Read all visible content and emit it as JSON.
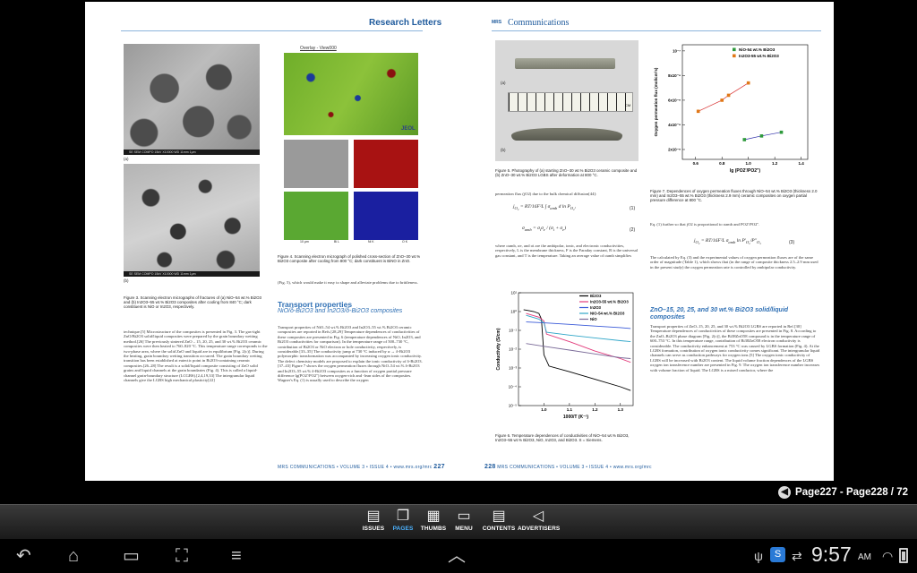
{
  "left_page": {
    "running_head": "Research Letters",
    "fig3_caption": "Figure 3. Scanning electron micrographs of fractures of (a) NiO–54 wt.% Bi2O3 and (b) In2O3–55 wt.% Bi2O3 composites after cooling from 840 °C; dark constituent is NiO or In2O3, respectively.",
    "fig3_label_a": "(a)",
    "fig3_label_b": "(b)",
    "sem_strip": "SE   SEM   COMPO   15kV   X10000   WD 11mm   1μm",
    "overlay_title": "Overlay - View000",
    "jeol_logo": "JEOL",
    "eds_labels": [
      "10 μm",
      "Bi L",
      "Ni K",
      "O K"
    ],
    "fig4_caption": "Figure 4. Scanning electron micrograph of polished cross-section of ZnO–30 wt.% Bi2O3 composite after cooling from 800 °C; dark constituent is BiNO in ZnO.",
    "col1_text": "technique.[5] Microstructure of the composites is presented in Fig. 3.\nThe gas-tight ZnO/Bi2O3 solid/liquid composites were prepared by the grain boundary wetting method.[26] The previously sintered ZnO – 15, 20, 25, and 30 wt.% Bi2O3 ceramic composites were then heated to 760–820 °C. This temperature range corresponds to the two-phase area, where the solid ZnO and liquid are in equilibrium [Fig. 2(c)]. During the heating, grain boundary wetting transition occurred. The grain boundary wetting transition has been established at eutectic point in Bi2O3-containing ceramic composites.[26–28] The result is a solid/liquid composite consisting of ZnO solid grains and liquid channels at the grain boundaries (Fig. 4). This is called a liquid-channel grain-boundary structure (LCGBS).[2,4,19,33] The intergranular liquid channels give the LGBS high mechanical plasticity[22]",
    "col2_text_top": "(Fig. 5), which would make it easy to shape and alleviate problems due to brittleness.",
    "section_title": "Transport properties",
    "section_subtitle": "NiO/δ-Bi2O3 and In2O3/δ-Bi2O3 composites",
    "col2_text": "Transport properties of NiO–54 wt.% Bi2O3 and In2O3–55 wt.% Bi2O3 ceramic composites are reported in Refs.[28,29] Temperature dependences of conductivities of these composites are presented in Fig. 6 (temperature dependences of NiO, In2O3, and Bi2O3 conductivities for comparison). In the temperature range of 500–730 °C, contribution of Bi2O3 or NiO electron or hole conductivity, respectively, is considerable.[33–35] The conductivity jump at 730 °C induced by α → δ-Bi2O3 polymorphic transformation was accompanied by increasing oxygen ionic conductivity. The defect chemistry models are proposed to explain the ionic conductivity of δ-Bi2O3.[37–43]\nFigure 7 shows the oxygen permeation fluxes through NiO–54 wt.% δ-Bi2O3 and In2O3–55 wt.% δ-Bi2O3 composites as a function of oxygen partial pressure difference lg(PO2'/PO2'') between oxygen-rich and -lean sides of the composites. Wagner's Eq. (1) is usually used to describe the oxygen",
    "footer_text": "MRS COMMUNICATIONS • VOLUME 3 • ISSUE 4 • www.mrs.org/mrc",
    "page_number": "227"
  },
  "right_page": {
    "logo_prefix": "MRS",
    "logo_main": "Communications",
    "fig5_label_a": "(a)",
    "fig5_label_b": "(b)",
    "ruler_unit": "CM",
    "fig5_caption": "Figure 5. Photography of (a) starting ZnO–30 wt.% Bi2O3 ceramic composite and (b) ZnO–30 wt.% Bi2O3 LGBS after deformation at 800 °C.",
    "fig6_caption": "Figure 6. Temperature dependences of conductivities of NiO–54 wt.% Bi2O3, In2O3–55 wt.% Bi2O3, NiO, In2O3, and Bi2O3. S = Siemens.",
    "mid_text": "permeation flux (jO2) due to the bulk chemical diffusion[44]:",
    "eq1_num": "(1)",
    "eq2_num": "(2)",
    "mid_text_2": "where σamb, σe, and σi are the ambipolar, ionic, and electronic conductivities, respectively, L is the membrane thickness, F is the Faraday constant, R is the universal gas constant, and T is the temperature. Taking an average value of σamb simplifies",
    "fig7_caption": "Figure 7. Dependences of oxygen permeation fluxes through NiO–54 wt.% Bi2O3 (thickness 2.0 mm) and In2O3–55 wt.% Bi2O3 (thickness 2.9 mm) ceramic composites on oxygen partial pressure difference at 800 °C.",
    "col_right_text_1": "Eq. (1) further so that jO2 is proportional to σamb and PO2'/PO2''.",
    "eq3_num": "(3)",
    "col_right_text_2": "The calculated by Eq. (3) and the experimental values of oxygen permeation fluxes are of the same order of magnitude (Table 1), which shows that (in the range of composite thickness 2.5–2.9 mm used in the present study) the oxygen permeation rate is controlled by ambipolar conductivity.",
    "section_title": "ZnO–15, 20, 25, and 30 wt.% Bi2O3 solid/liquid composites",
    "col_right_text_3": "Transport properties of ZnO–15, 20, 25, and 30 wt.% Bi2O3 LGBS are reported in Ref.[30] Temperature dependences of conductivities of these composites are presented in Fig. 8. According to the ZnO–Bi2O3 phase diagram [Fig. 2(c)], the Bi38ZnO58 compound is in the temperature range of 600–753 °C. In this temperature range, contribution of Bi38ZnO58 electron conductivity is considerable. The conductivity enhancement at 753 °C was caused by LGBS formation (Fig. 4). At the LGBS formation, contribution of oxygen ionic conductivity comes significant. The intergranular liquid channels can serve as conduction pathways for oxygen ions.[5] The oxygen ionic conductivity of LGBS will be increased with Bi2O3 content.\nThe liquid volume fraction dependences of the LGBS oxygen ion transference number are presented in Fig. 9. The oxygen ion transference number increases with volume fraction of liquid. The LGBS is a mixed conductor, where the",
    "footer_text": "MRS COMMUNICATIONS • VOLUME 3 • ISSUE 4 • www.mrs.org/mrc",
    "page_number": "228"
  },
  "chart_data": [
    {
      "type": "line",
      "xlabel": "1000/T (K⁻¹)",
      "ylabel": "Conductivity (S/cm)",
      "x_ticks": [
        "1.0",
        "1.1",
        "1.2",
        "1.3"
      ],
      "y_ticks": [
        "10¹",
        "10⁰",
        "10⁻¹",
        "10⁻²",
        "10⁻³",
        "10⁻⁴",
        "10⁻⁵"
      ],
      "xlim": [
        0.9,
        1.35
      ],
      "ylim_log10": [
        -5,
        1
      ],
      "legend_position": "top-right",
      "series": [
        {
          "name": "Bi2O3",
          "color": "#000000",
          "x": [
            0.92,
            0.94,
            0.96,
            0.98,
            0.99,
            1.0,
            1.02,
            1.1,
            1.2,
            1.3,
            1.34
          ],
          "log_y": [
            0.1,
            0.05,
            0.0,
            -0.1,
            -0.4,
            -2.3,
            -2.9,
            -3.2,
            -3.6,
            -4.0,
            -4.2
          ]
        },
        {
          "name": "In2O3-55 wt.% Bi2O3",
          "color": "#e23a7a",
          "x": [
            0.93,
            0.98,
            1.0,
            1.01,
            1.1,
            1.2,
            1.3,
            1.34
          ],
          "log_y": [
            -0.1,
            -0.3,
            -0.5,
            -1.2,
            -1.6,
            -2.1,
            -2.5,
            -2.7
          ]
        },
        {
          "name": "In2O3",
          "color": "#3a5ad8",
          "x": [
            0.93,
            1.0,
            1.1,
            1.2,
            1.3,
            1.34
          ],
          "log_y": [
            -0.55,
            -0.6,
            -0.68,
            -0.77,
            -0.85,
            -0.9
          ]
        },
        {
          "name": "NiO-54 wt.% Bi2O3",
          "color": "#30a6c8",
          "x": [
            0.93,
            0.98,
            1.0,
            1.01,
            1.1,
            1.2,
            1.3,
            1.34
          ],
          "log_y": [
            -0.2,
            -0.4,
            -0.6,
            -1.1,
            -1.25,
            -1.4,
            -1.55,
            -1.6
          ]
        },
        {
          "name": "NiO",
          "color": "#7a6a98",
          "x": [
            0.93,
            1.0,
            1.1,
            1.2,
            1.3,
            1.34
          ],
          "log_y": [
            -1.7,
            -1.85,
            -2.05,
            -2.25,
            -2.45,
            -2.5
          ]
        }
      ]
    },
    {
      "type": "scatter",
      "xlabel": "lg (PO2'/PO2'')",
      "ylabel": "Oxygen permeation flux (mol/cm²s)",
      "x_ticks": [
        "0.6",
        "0.8",
        "1.0",
        "1.2",
        "1.4"
      ],
      "y_ticks": [
        "2x10⁻⁸",
        "4x10⁻⁸",
        "6x10⁻⁸",
        "8x10⁻⁸",
        "10⁻⁷"
      ],
      "xlim": [
        0.5,
        1.45
      ],
      "ylim": [
        1.2e-08,
        1.05e-07
      ],
      "legend_position": "top-right",
      "series": [
        {
          "name": "NiO-54 wt.% Bi2O3",
          "color": "#2e9a3c",
          "x": [
            0.97,
            1.1,
            1.25
          ],
          "y": [
            2.8e-08,
            3.1e-08,
            3.4e-08
          ]
        },
        {
          "name": "In2O3-55 wt.% Bi2O3",
          "color": "#e07818",
          "x": [
            0.62,
            0.8,
            0.85,
            1.0
          ],
          "y": [
            5.1e-08,
            6e-08,
            6.4e-08,
            7.4e-08
          ]
        }
      ]
    }
  ],
  "page_indicator": {
    "text": "Page227 - Page228 / 72",
    "back_icon": "back-arrow-icon"
  },
  "toolbar": {
    "items": [
      {
        "label": "ISSUES",
        "icon": "issues-icon",
        "glyph": "▤"
      },
      {
        "label": "PAGES",
        "icon": "pages-icon",
        "glyph": "❐"
      },
      {
        "label": "THUMBS",
        "icon": "thumbs-icon",
        "glyph": "▦"
      },
      {
        "label": "MENU",
        "icon": "menu-icon",
        "glyph": "▭"
      },
      {
        "label": "CONTENTS",
        "icon": "contents-icon",
        "glyph": "▤"
      },
      {
        "label": "ADVERTISERS",
        "icon": "megaphone-icon",
        "glyph": "◁"
      }
    ],
    "active": "PAGES"
  },
  "system_bar": {
    "time": "9:57",
    "ampm": "AM",
    "nav": {
      "back": "↶",
      "home": "⌂",
      "recent": "▭",
      "screenshot": "⛶",
      "menu": "≡",
      "up": "︿"
    }
  }
}
